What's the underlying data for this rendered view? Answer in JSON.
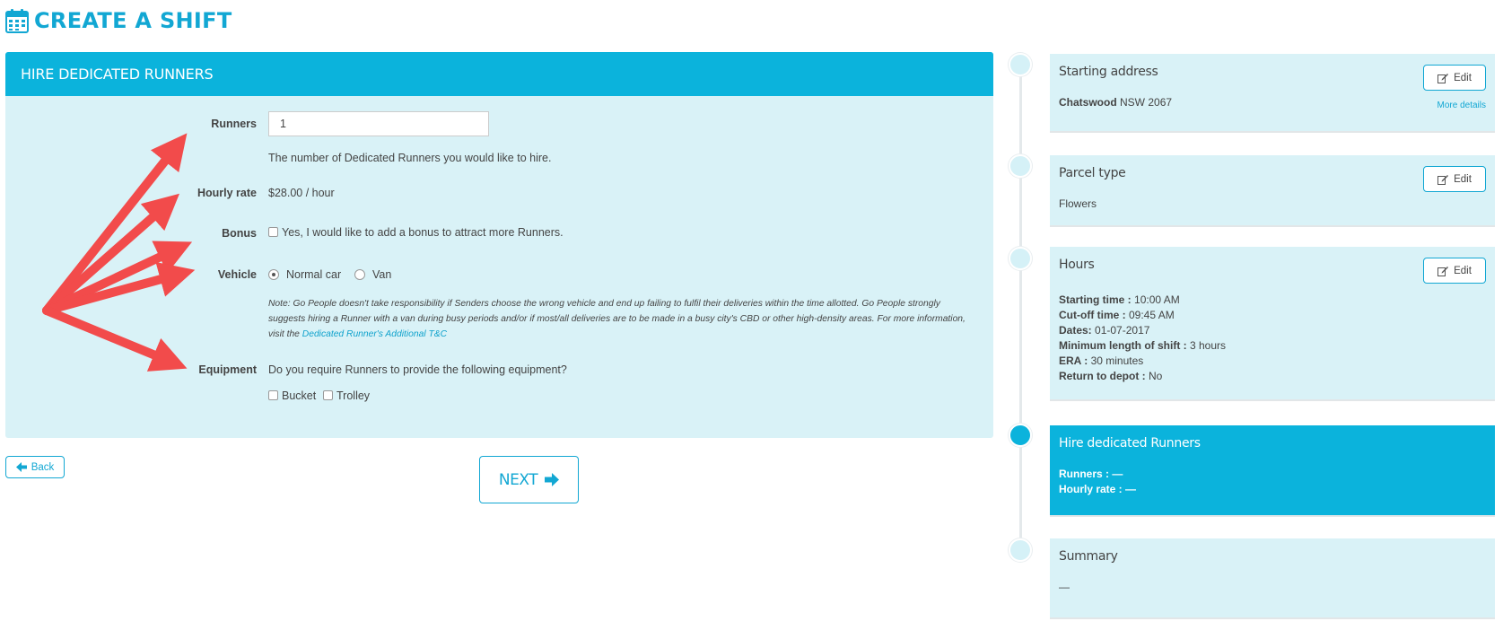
{
  "page": {
    "title": "CREATE A SHIFT"
  },
  "form": {
    "header": "HIRE DEDICATED RUNNERS",
    "runners": {
      "label": "Runners",
      "value": "1",
      "help": "The number of Dedicated Runners you would like to hire."
    },
    "hourly_rate": {
      "label": "Hourly rate",
      "value": "$28.00 / hour"
    },
    "bonus": {
      "label": "Bonus",
      "checkbox_label": "Yes, I would like to add a bonus to attract more Runners.",
      "checked": false
    },
    "vehicle": {
      "label": "Vehicle",
      "options": [
        {
          "label": "Normal car",
          "selected": true
        },
        {
          "label": "Van",
          "selected": false
        }
      ]
    },
    "note": {
      "text": "Note: Go People doesn't take responsibility if Senders choose the wrong vehicle and end up failing to fulfil their deliveries within the time allotted. Go People strongly suggests hiring a Runner with a van during busy periods and/or if most/all deliveries are to be made in a busy city's CBD or other high-density areas. For more information, visit the",
      "link": "Dedicated Runner's Additional T&C"
    },
    "equipment": {
      "label": "Equipment",
      "question": "Do you require Runners to provide the following equipment?",
      "options": [
        {
          "label": "Bucket",
          "checked": false
        },
        {
          "label": "Trolley",
          "checked": false
        }
      ]
    }
  },
  "nav": {
    "back_label": "Back",
    "next_label": "NEXT"
  },
  "steps": {
    "starting_address": {
      "title": "Starting address",
      "edit_label": "Edit",
      "suburb": "Chatswood",
      "postcode": "NSW 2067",
      "more_details": "More details"
    },
    "parcel_type": {
      "title": "Parcel type",
      "edit_label": "Edit",
      "value": "Flowers"
    },
    "hours": {
      "title": "Hours",
      "edit_label": "Edit",
      "rows": [
        {
          "key": "Starting time :",
          "value": "10:00 AM"
        },
        {
          "key": "Cut-off time :",
          "value": "09:45 AM"
        },
        {
          "key": "Dates:",
          "value": "01-07-2017"
        },
        {
          "key": "Minimum length of shift :",
          "value": "3 hours"
        },
        {
          "key": "ERA :",
          "value": "30 minutes"
        },
        {
          "key": "Return to depot :",
          "value": "No"
        }
      ]
    },
    "hire": {
      "title": "Hire dedicated Runners",
      "rows": [
        {
          "key": "Runners :",
          "value": "—"
        },
        {
          "key": "Hourly rate :",
          "value": "—"
        }
      ]
    },
    "summary": {
      "title": "Summary",
      "value": "—"
    }
  },
  "colors": {
    "accent": "#0bb3dc",
    "panel_bg": "#d9f2f7",
    "annotation_arrow": "#f24b4b"
  }
}
